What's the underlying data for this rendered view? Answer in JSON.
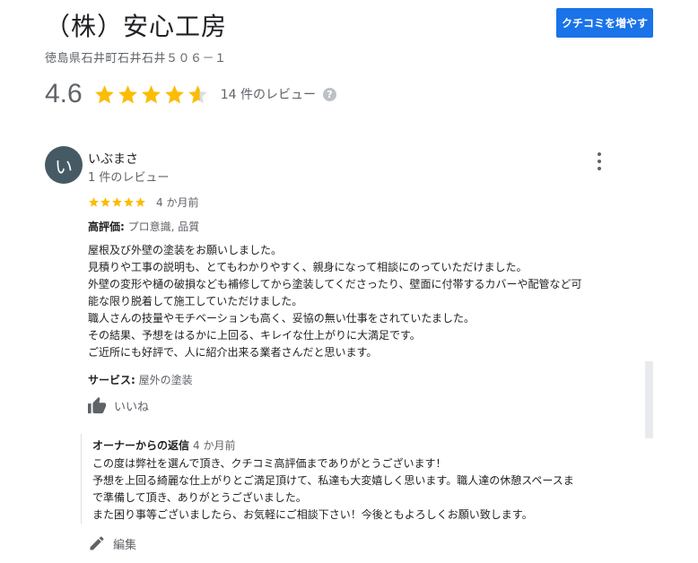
{
  "header": {
    "title": "（株）安心工房",
    "address": "徳島県石井町石井石井５０６－１",
    "review_button_label": "クチコミを増やす"
  },
  "summary": {
    "rating": "4.6",
    "rating_value": 4.6,
    "max_rating": 5,
    "review_count_label": "14 件のレビュー",
    "help_icon": "?"
  },
  "review": {
    "avatar_letter": "い",
    "user_name": "いぶまさ",
    "user_sub": "1 件のレビュー",
    "stars": 5,
    "time": "4 か月前",
    "highlights_label": "高評価:",
    "highlights_value": "プロ意識, 品質",
    "body_lines": [
      "屋根及び外壁の塗装をお願いしました。",
      "見積りや工事の説明も、とてもわかりやすく、親身になって相談にのっていただけました。",
      "外壁の変形や樋の破損なども補修してから塗装してくださったり、壁面に付帯するカバーや配管など可",
      "能な限り脱着して施工していただけました。",
      "職人さんの技量やモチベーションも高く、妥協の無い仕事をされていたました。",
      "その結果、予想をはるかに上回る、キレイな仕上がりに大満足です。",
      "ご近所にも好評で、人に紹介出来る業者さんだと思います。"
    ],
    "services_label": "サービス:",
    "services_value": "屋外の塗装",
    "like_label": "いいね"
  },
  "owner_reply": {
    "heading": "オーナーからの返信",
    "time": "4 か月前",
    "body_lines": [
      "この度は弊社を選んで頂き、クチコミ高評価までありがとうございます！",
      "予想を上回る綺麗な仕上がりとご満足頂けて、私達も大変嬉しく思います。職人達の休憩スペースま",
      "で準備して頂き、ありがとうございました。",
      "また困り事等ございましたら、お気軽にご相談下さい！今後ともよろしくお願い致します。"
    ]
  },
  "actions": {
    "edit_label": "編集"
  },
  "colors": {
    "accent": "#1a73e8",
    "star": "#fbbc04",
    "avatar": "#455a64",
    "muted_text": "#5f6368"
  },
  "icons": {
    "more": "more-vert-icon",
    "like": "thumb-up-icon",
    "edit": "pencil-icon",
    "help": "help-icon",
    "star": "star-icon"
  }
}
